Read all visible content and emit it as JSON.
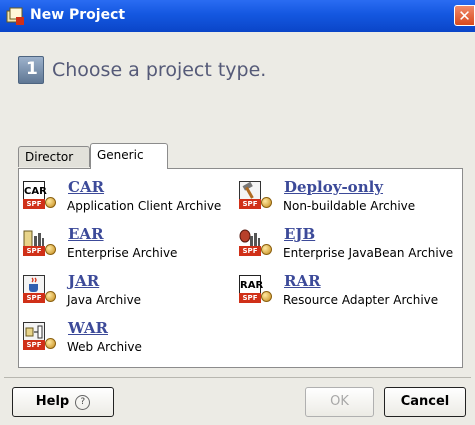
{
  "window": {
    "title": "New Project",
    "close_glyph": "✕"
  },
  "header": {
    "step_number": "1",
    "heading": "Choose a project type."
  },
  "tabs": [
    {
      "label": "Director",
      "active": false
    },
    {
      "label": "Generic",
      "active": true
    }
  ],
  "items": [
    {
      "name": "CAR",
      "description": "Application Client Archive",
      "chip": "CAR",
      "icon": "car-icon"
    },
    {
      "name": "Deploy-only",
      "description": "Non-buildable Archive",
      "chip": "",
      "icon": "hammer-icon"
    },
    {
      "name": "EAR",
      "description": "Enterprise Archive",
      "chip": "",
      "icon": "ear-icon"
    },
    {
      "name": "EJB",
      "description": "Enterprise JavaBean Archive",
      "chip": "",
      "icon": "ejb-icon"
    },
    {
      "name": "JAR",
      "description": "Java Archive",
      "chip": "",
      "icon": "java-cup-icon"
    },
    {
      "name": "RAR",
      "description": "Resource Adapter Archive",
      "chip": "RAR",
      "icon": "rar-icon"
    },
    {
      "name": "WAR",
      "description": "Web Archive",
      "chip": "",
      "icon": "war-icon"
    }
  ],
  "badge": "SPF",
  "buttons": {
    "help": "Help",
    "help_glyph": "?",
    "ok": "OK",
    "cancel": "Cancel"
  },
  "colors": {
    "titlebar": "#1457e0",
    "link": "#3c4a99",
    "spf_badge": "#d03018"
  }
}
